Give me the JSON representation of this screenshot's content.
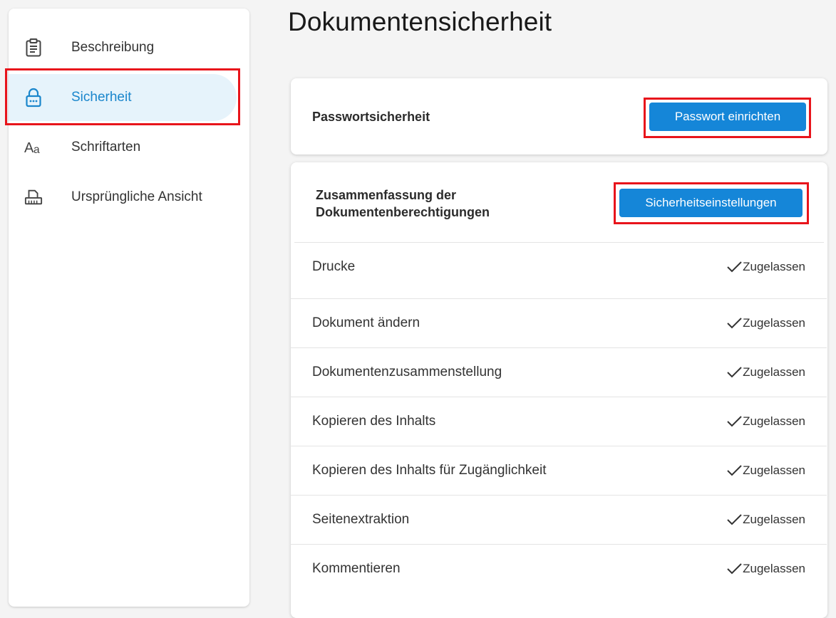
{
  "sidebar": {
    "items": [
      {
        "label": "Beschreibung",
        "icon": "clipboard-icon"
      },
      {
        "label": "Sicherheit",
        "icon": "lock-icon",
        "active": true
      },
      {
        "label": "Schriftarten",
        "icon": "font-icon"
      },
      {
        "label": "Ursprüngliche Ansicht",
        "icon": "initial-view-icon"
      }
    ]
  },
  "page": {
    "title": "Dokumentensicherheit"
  },
  "password_card": {
    "title": "Passwortsicherheit",
    "button_label": "Passwort einrichten"
  },
  "permissions_card": {
    "title_line1": "Zusammenfassung der",
    "title_line2": "Dokumentenberechtigungen",
    "button_label": "Sicherheitseinstellungen",
    "rows": [
      {
        "label": "Drucke",
        "status": "Zugelassen"
      },
      {
        "label": "Dokument ändern",
        "status": "Zugelassen"
      },
      {
        "label": "Dokumentenzusammenstellung",
        "status": "Zugelassen"
      },
      {
        "label": "Kopieren des Inhalts",
        "status": "Zugelassen"
      },
      {
        "label": "Kopieren des Inhalts für Zugänglichkeit",
        "status": "Zugelassen"
      },
      {
        "label": "Seitenextraktion",
        "status": "Zugelassen"
      },
      {
        "label": "Kommentieren",
        "status": "Zugelassen"
      }
    ]
  },
  "colors": {
    "accent": "#1586d8",
    "active_bg": "#e6f3fb",
    "active_text": "#1a86cc",
    "highlight": "#e8141b"
  }
}
